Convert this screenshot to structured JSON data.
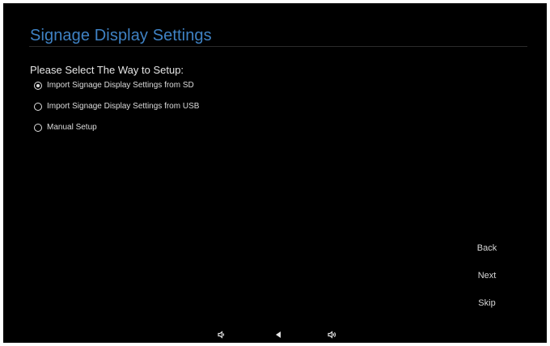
{
  "title": "Signage Display Settings",
  "prompt": "Please Select The Way to Setup:",
  "options": [
    {
      "label": "Import Signage Display Settings from SD",
      "selected": true
    },
    {
      "label": "Import Signage Display Settings from USB",
      "selected": false
    },
    {
      "label": "Manual Setup",
      "selected": false
    }
  ],
  "buttons": {
    "back": "Back",
    "next": "Next",
    "skip": "Skip"
  },
  "system_bar": {
    "icons": [
      "volume-down-icon",
      "back-triangle-icon",
      "volume-up-icon"
    ]
  },
  "colors": {
    "background": "#000000",
    "title": "#3f82c4",
    "text": "#e6e6e6"
  }
}
